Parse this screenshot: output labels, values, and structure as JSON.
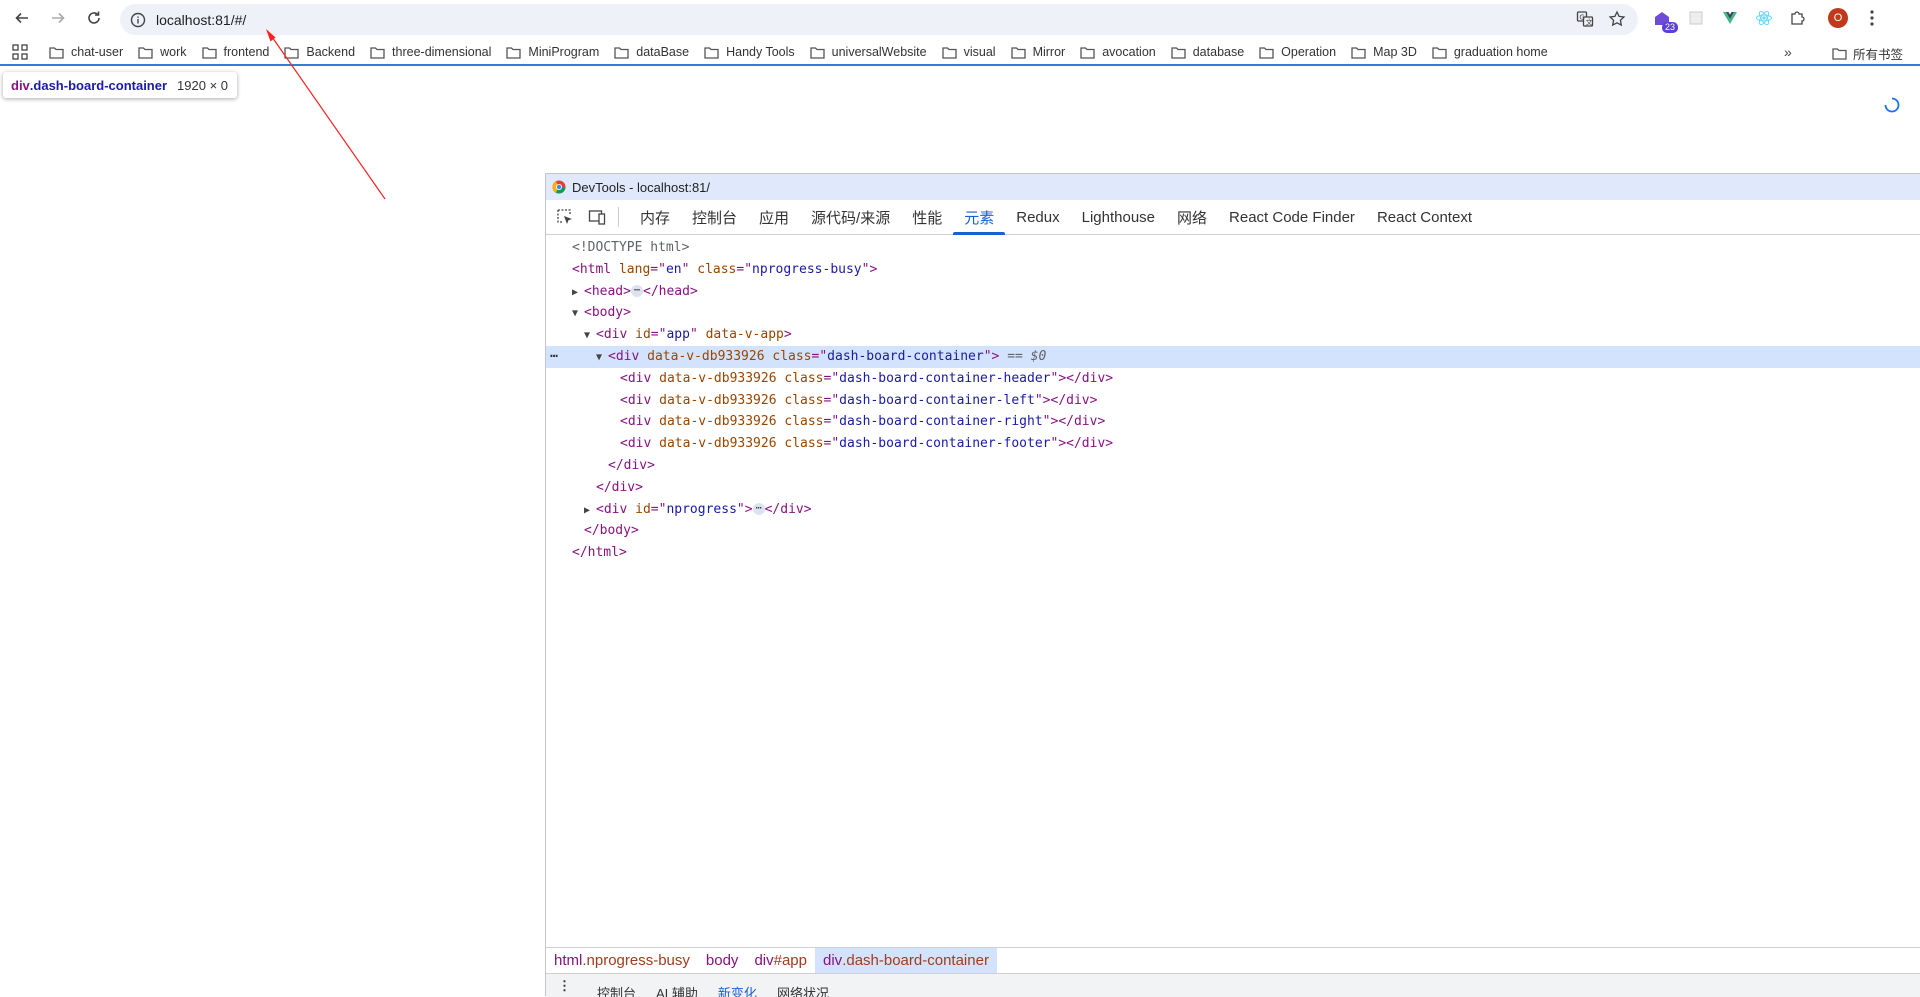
{
  "browser": {
    "url": "localhost:81/#/",
    "extension_badge": "23",
    "profile_initial": "O"
  },
  "bookmarks": {
    "items": [
      "chat-user",
      "work",
      "frontend",
      "Backend",
      "three-dimensional",
      "MiniProgram",
      "dataBase",
      "Handy Tools",
      "universalWebsite",
      "visual",
      "Mirror",
      "avocation",
      "database",
      "Operation",
      "Map 3D",
      "graduation home"
    ],
    "more": "»",
    "all_bookmarks": "所有书签"
  },
  "inspect_tooltip": {
    "tag": "div",
    "class": ".dash-board-container",
    "dims": "1920 × 0"
  },
  "devtools": {
    "title": "DevTools - localhost:81/",
    "tabs": [
      "内存",
      "控制台",
      "应用",
      "源代码/来源",
      "性能",
      "元素",
      "Redux",
      "Lighthouse",
      "网络",
      "React Code Finder",
      "React Context"
    ],
    "active_tab": "元素",
    "dom": {
      "doctype": "<!DOCTYPE html>",
      "html_open": {
        "tag": "html",
        "attrs": [
          [
            "lang",
            "en"
          ],
          [
            "class",
            "nprogress-busy"
          ]
        ]
      },
      "head": {
        "open": "<head>",
        "close": "</head>"
      },
      "body_open": "<body>",
      "app_open": {
        "tag": "div",
        "attrs": [
          [
            "id",
            "app"
          ]
        ],
        "bool_attr": "data-v-app"
      },
      "container_open": {
        "tag": "div",
        "bool_attr": "data-v-db933926",
        "attrs": [
          [
            "class",
            "dash-board-container"
          ]
        ],
        "ref": "== $0"
      },
      "children": [
        {
          "bool_attr": "data-v-db933926",
          "class": "dash-board-container-header"
        },
        {
          "bool_attr": "data-v-db933926",
          "class": "dash-board-container-left"
        },
        {
          "bool_attr": "data-v-db933926",
          "class": "dash-board-container-right"
        },
        {
          "bool_attr": "data-v-db933926",
          "class": "dash-board-container-footer"
        }
      ],
      "div_close": "</div>",
      "nprogress": {
        "tag": "div",
        "attrs": [
          [
            "id",
            "nprogress"
          ]
        ]
      },
      "body_close": "</body>",
      "html_close": "</html>"
    },
    "breadcrumbs": [
      {
        "tag": "html",
        "cls": ".nprogress-busy"
      },
      {
        "tag": "body",
        "cls": ""
      },
      {
        "tag": "div",
        "cls": "#app"
      },
      {
        "tag": "div",
        "cls": ".dash-board-container"
      }
    ],
    "drawer_tabs": [
      "控制台",
      "AI 辅助",
      "新变化",
      "网络状况"
    ],
    "drawer_active": "新变化"
  }
}
